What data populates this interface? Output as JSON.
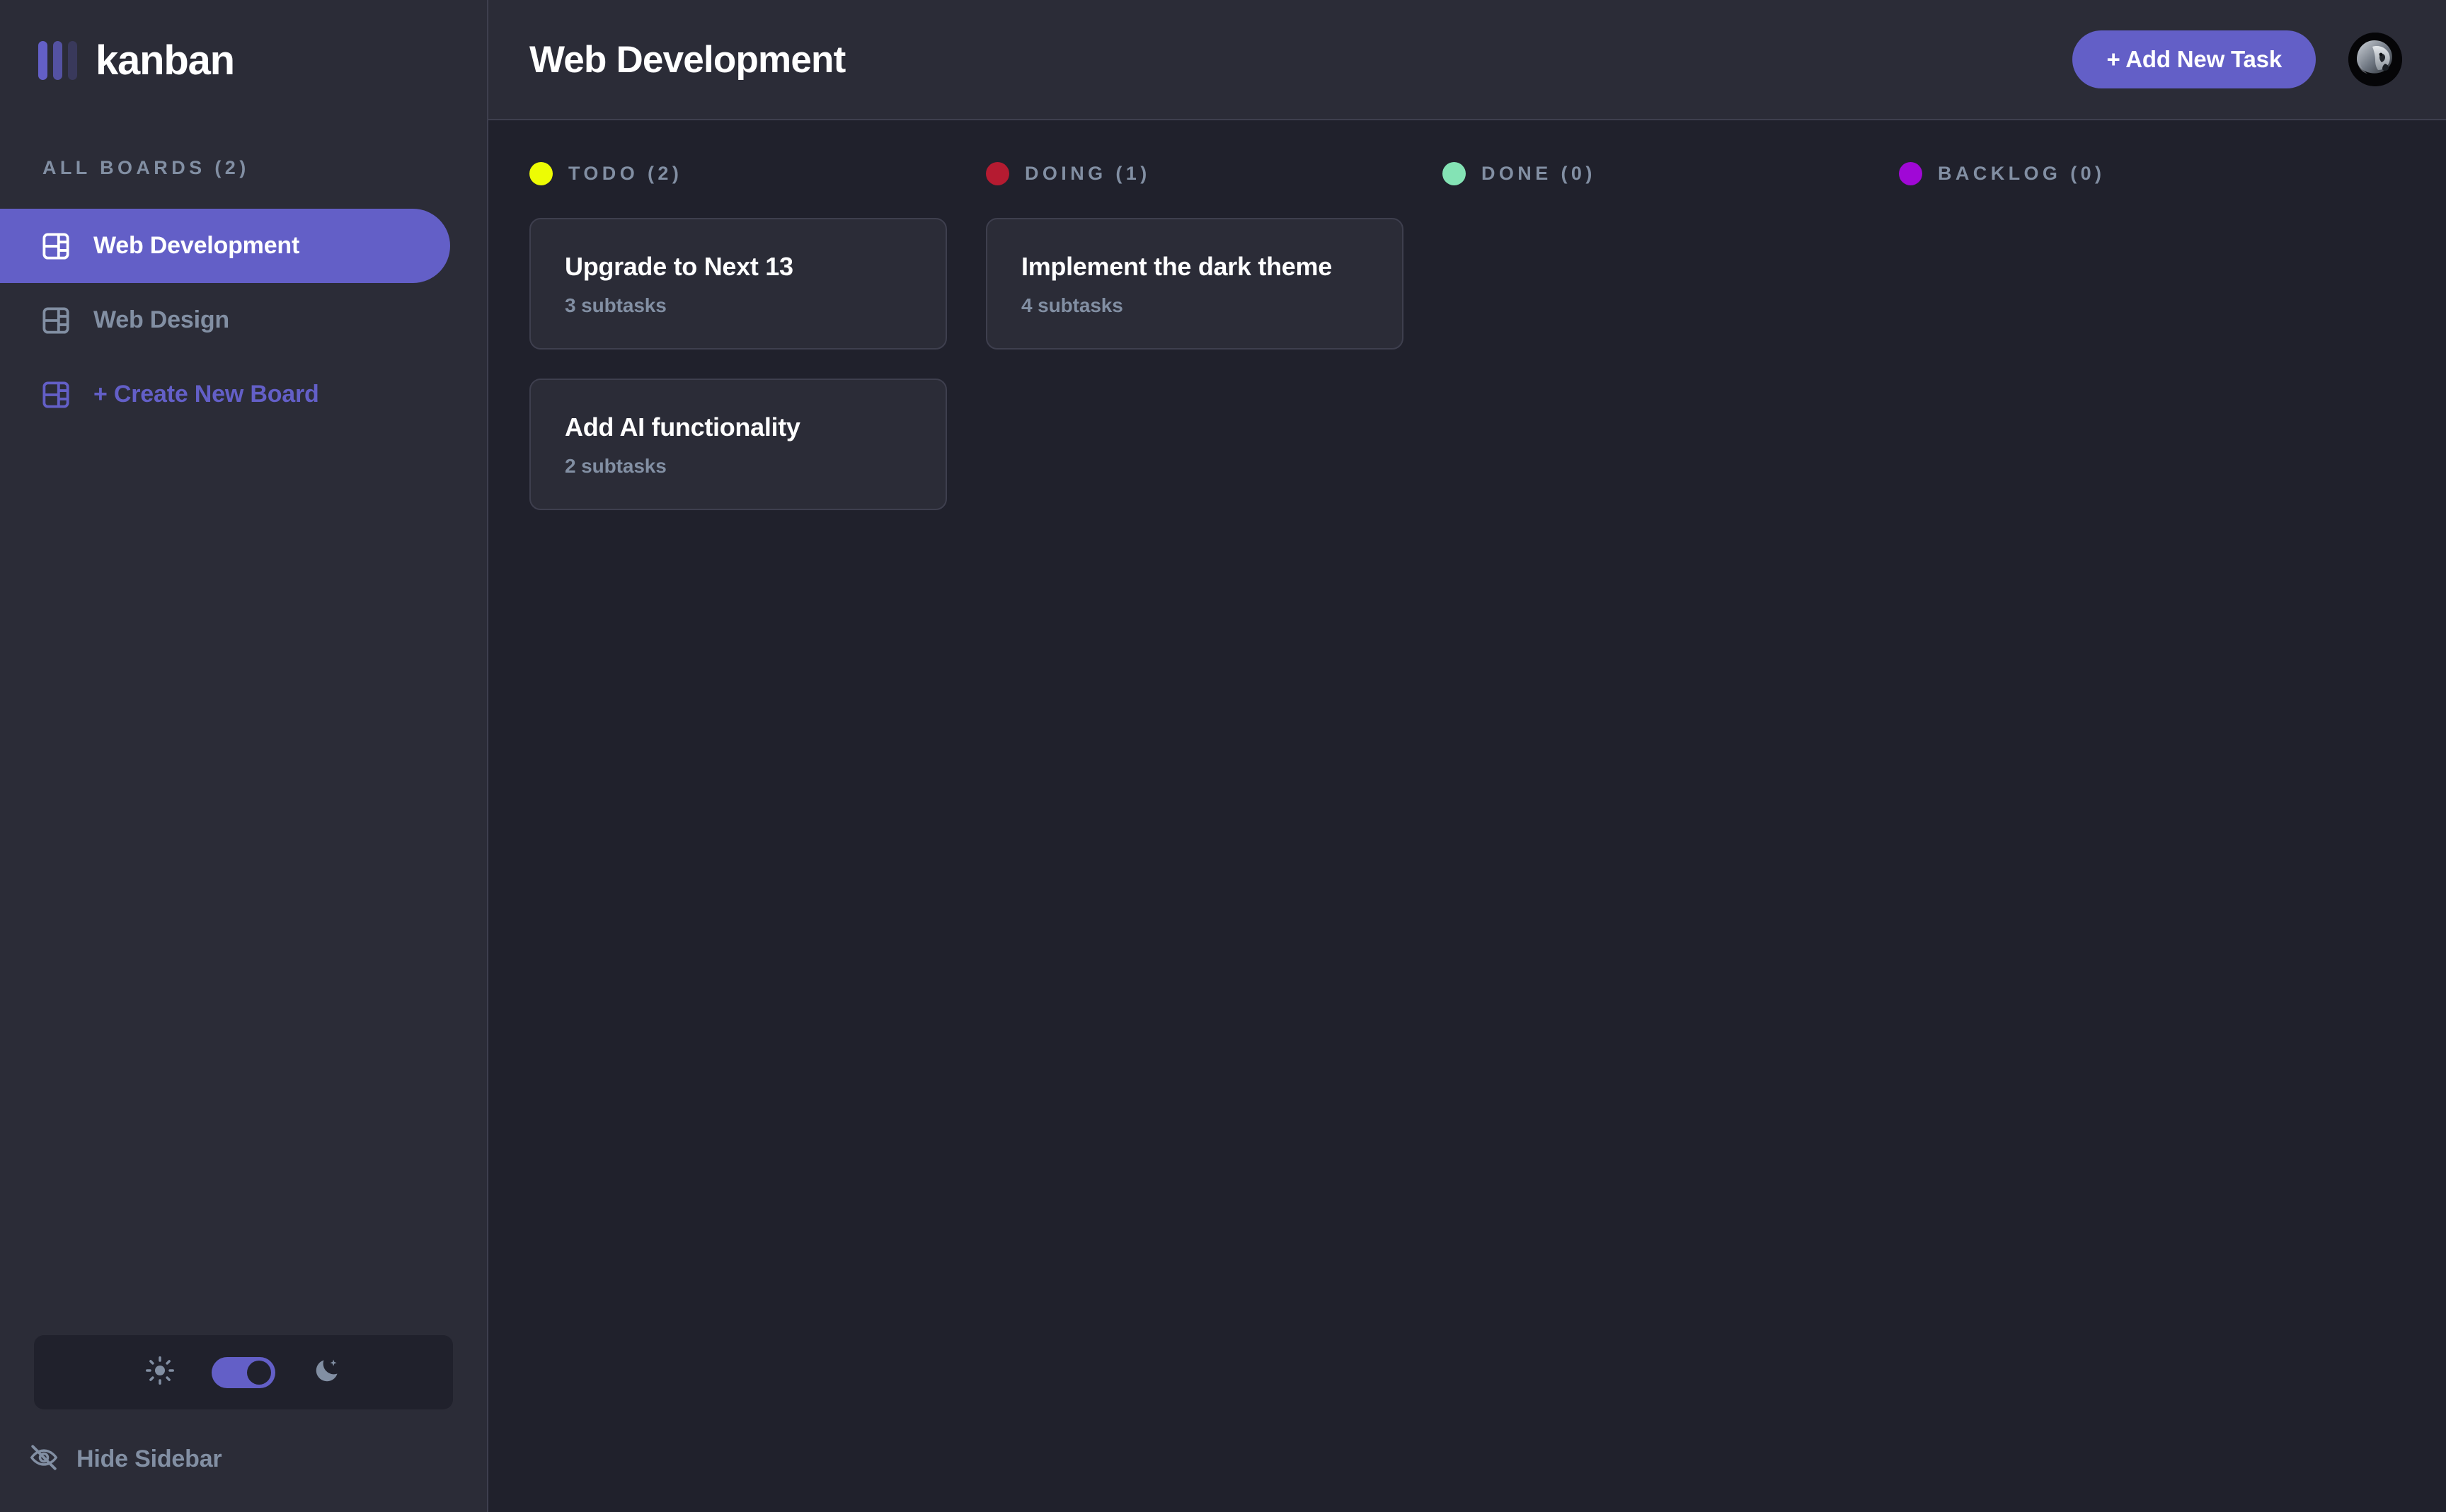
{
  "app": {
    "name": "kanban",
    "logo_color": "#635fc7"
  },
  "sidebar": {
    "boards_heading": "ALL BOARDS (2)",
    "items": [
      {
        "label": "Web Development",
        "active": true
      },
      {
        "label": "Web Design",
        "active": false
      }
    ],
    "create_board_label": "+ Create New Board",
    "theme_toggle": {
      "light_icon": "sun-icon",
      "dark_icon": "moon-icon",
      "state": "dark",
      "accent": "#635fc7"
    },
    "hide_sidebar_label": "Hide Sidebar",
    "hide_sidebar_icon": "eye-off-icon"
  },
  "header": {
    "title": "Web Development",
    "add_task_label": "+ Add New Task",
    "avatar": "lion-avatar"
  },
  "board": {
    "columns": [
      {
        "name": "TODO (2)",
        "dot_color": "#edfc04",
        "cards": [
          {
            "title": "Upgrade to Next 13",
            "subtasks": "3 subtasks"
          },
          {
            "title": "Add AI functionality",
            "subtasks": "2 subtasks"
          }
        ]
      },
      {
        "name": "DOING (1)",
        "dot_color": "#b51b31",
        "cards": [
          {
            "title": "Implement the dark theme",
            "subtasks": "4 subtasks"
          }
        ]
      },
      {
        "name": "DONE (0)",
        "dot_color": "#84e3b5",
        "cards": []
      },
      {
        "name": "BACKLOG (0)",
        "dot_color": "#a008d6",
        "cards": []
      }
    ]
  }
}
